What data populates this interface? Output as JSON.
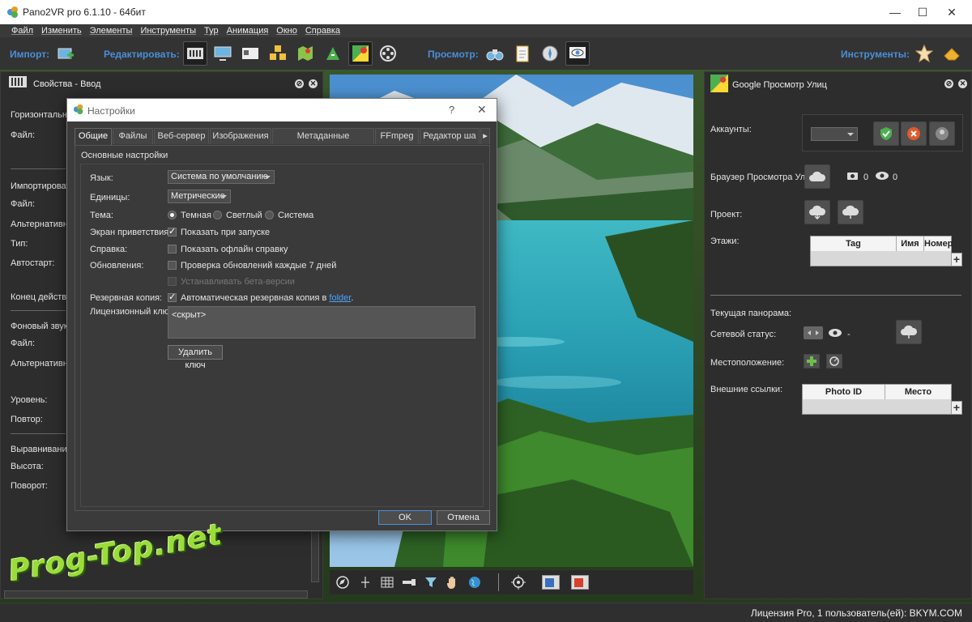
{
  "window": {
    "title": "Pano2VR pro 6.1.10 - 64бит"
  },
  "menu": [
    "Файл",
    "Изменить",
    "Элементы",
    "Инструменты",
    "Тур",
    "Анимация",
    "Окно",
    "Справка"
  ],
  "toolbar": {
    "import_label": "Импорт:",
    "edit_label": "Редактировать:",
    "preview_label": "Просмотр:",
    "tools_label": "Инструменты:"
  },
  "left_panel": {
    "title": "Свойства - Ввод",
    "labels": [
      "Горизонтальн",
      "Файл:",
      "Импортировать",
      "Файл:",
      "Альтернативны",
      "Тип:",
      "Автостарт:",
      "Конец действия",
      "Фоновый звук:",
      "Файл:",
      "Альтернативны",
      "Уровень:",
      "Повтор:",
      "Выравнивание:",
      "Высота:",
      "Поворот:"
    ]
  },
  "dialog": {
    "title": "Настройки",
    "help": "?",
    "tabs": [
      "Общие",
      "Файлы",
      "Веб-сервер",
      "Изображения",
      "Метаданные изображения",
      "FFmpeg",
      "Редактор ша"
    ],
    "section": "Основные настройки",
    "language_label": "Язык:",
    "language_value": "Система по умолчанию",
    "units_label": "Единицы:",
    "units_value": "Метрические",
    "theme_label": "Тема:",
    "theme_options": [
      "Темная",
      "Светлый",
      "Система"
    ],
    "welcome_label": "Экран приветствия:",
    "welcome_check": "Показать при запуске",
    "help_label": "Справка:",
    "help_check": "Показать офлайн справку",
    "updates_label": "Обновления:",
    "updates_check": "Проверка обновлений каждые 7 дней",
    "beta_check": "Устанавливать бета-версии",
    "backup_label": "Резервная копия:",
    "backup_check": "Автоматическая резервная копия в",
    "backup_link": "folder",
    "backup_period": ".",
    "license_label": "Лицензионный ключ:",
    "license_value": "<скрыт>",
    "delete_key": "Удалить ключ",
    "ok": "OK",
    "cancel": "Отмена"
  },
  "right_panel": {
    "title": "Google Просмотр Улиц",
    "accounts": "Аккаунты:",
    "browser": "Браузер Просмотра Улиц:",
    "photo_count": "0",
    "view_count": "0",
    "project": "Проект:",
    "floors": "Этажи:",
    "floors_cols": [
      "Tag",
      "Имя",
      "Номер"
    ],
    "current_pano": "Текущая панорама:",
    "net_status": "Сетевой статус:",
    "net_status_value": "-",
    "location": "Местоположение:",
    "external_links": "Внешние ссылки:",
    "links_cols": [
      "Photo ID",
      "Место"
    ]
  },
  "status": {
    "license": "Лицензия Pro, 1 пользователь(ей): BKYM.COM"
  },
  "watermark": "Prog-Top.net",
  "colors": {
    "accent": "#4a8fd8",
    "link": "#4aa3ff",
    "panel_bg": "#2d2d2d",
    "dialog_bg": "#3b3b3b"
  }
}
